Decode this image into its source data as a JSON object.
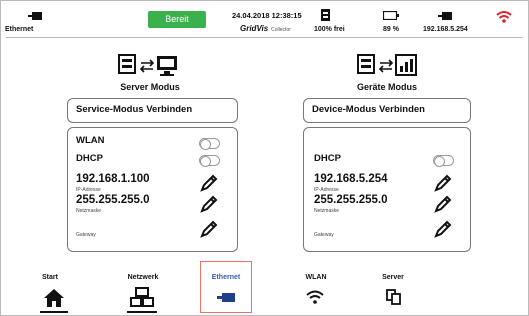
{
  "status_bar": {
    "connection_label": "Ethernet",
    "ready_badge": "Bereit",
    "datetime": "24.04.2018 12:38:15",
    "brand": "GridVis",
    "brand_sub": "Collector",
    "storage": "100% frei",
    "battery": "89 %",
    "ip": "192.168.5.254"
  },
  "server_panel": {
    "title": "Server Modus",
    "connect_button": "Service-Modus Verbinden",
    "wlan_label": "WLAN",
    "dhcp_label": "DHCP",
    "ip_value": "192.168.1.100",
    "ip_label": "IP-Adresse",
    "netmask_value": "255.255.255.0",
    "netmask_label": "Netzmaske",
    "gateway_label": "Gateway"
  },
  "device_panel": {
    "title": "Geräte Modus",
    "connect_button": "Device-Modus Verbinden",
    "dhcp_label": "DHCP",
    "ip_value": "192.168.5.254",
    "ip_label": "IP-Adresse",
    "netmask_value": "255.255.255.0",
    "netmask_label": "Netzmaske",
    "gateway_label": "Gateway"
  },
  "nav": {
    "start": "Start",
    "netzwerk": "Netzwerk",
    "ethernet": "Ethernet",
    "wlan": "WLAN",
    "server": "Server",
    "active": "ethernet",
    "active_color": "#e8726a"
  },
  "colors": {
    "ready": "#3bb14e",
    "wifi_icon": "#d9252f"
  }
}
